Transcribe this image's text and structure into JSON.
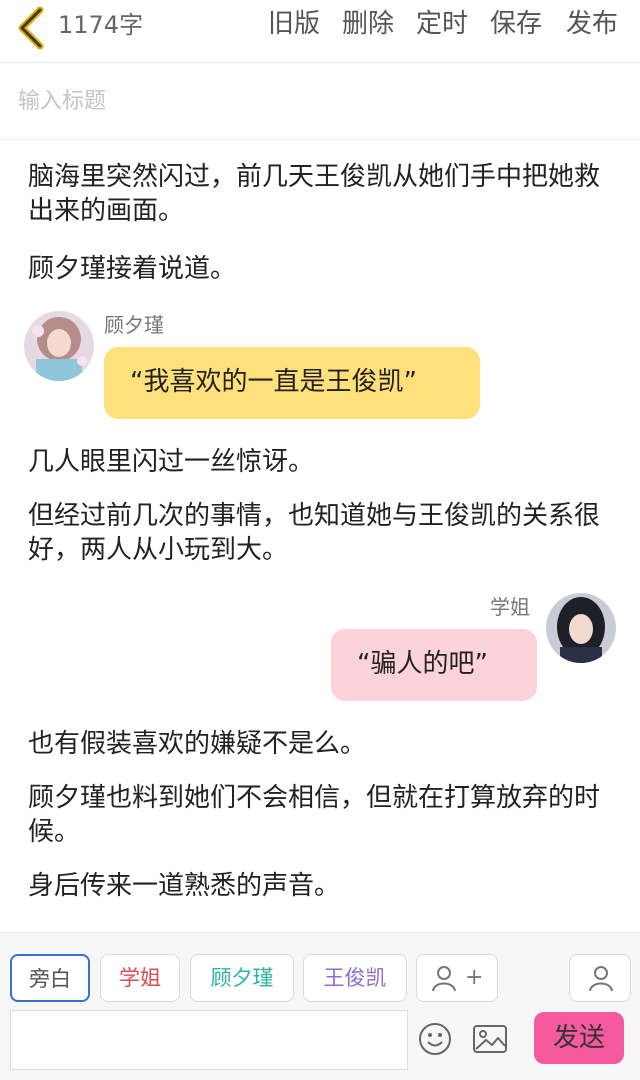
{
  "header": {
    "word_count": "1174字",
    "buttons": [
      "旧版",
      "删除",
      "定时",
      "保存",
      "发布"
    ]
  },
  "title_placeholder": "输入标题",
  "content": {
    "p1": "脑海里突然闪过，前几天王俊凯从她们手中把她救出来的画面。",
    "p2": "顾夕瑾接着说道。",
    "d1_speaker": "顾夕瑾",
    "d1_text": "“我喜欢的一直是王俊凯”",
    "p3": "几人眼里闪过一丝惊讶。",
    "p4": "但经过前几次的事情，也知道她与王俊凯的关系很好，两人从小玩到大。",
    "d2_speaker": "学姐",
    "d2_text": "“骗人的吧”",
    "p5": "也有假装喜欢的嫌疑不是么。",
    "p6": "顾夕瑾也料到她们不会相信，但就在打算放弃的时候。",
    "p7": "身后传来一道熟悉的声音。"
  },
  "roles": {
    "narration": "旁白",
    "r1": "学姐",
    "r2": "顾夕瑾",
    "r3": "王俊凯",
    "add": "+"
  },
  "colors": {
    "narration": "#3b6fd0",
    "r1": "#e24c4c",
    "r2": "#2cb5a6",
    "r3": "#8b6fd0",
    "send_bg": "#f45a9d",
    "bubble_yellow": "#ffe07a",
    "bubble_pink": "#fcd3da"
  },
  "composer": {
    "input_value": "",
    "send_label": "发送"
  },
  "icons": [
    "back-chevron-icon",
    "add-role-icon",
    "role-manage-icon",
    "emoji-icon",
    "image-icon"
  ]
}
